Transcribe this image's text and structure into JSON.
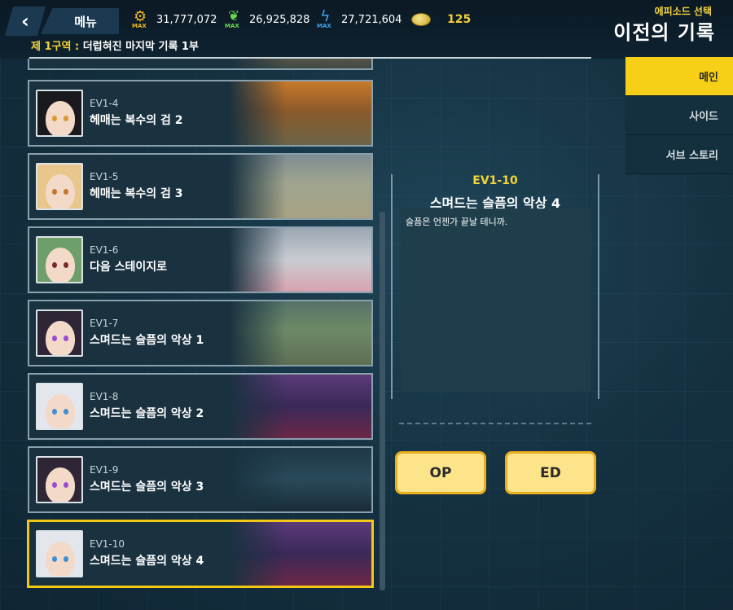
{
  "header": {
    "back_icon": "chevron-left-icon",
    "menu_label": "메뉴",
    "resources": [
      {
        "icon": "gear-max-icon",
        "max_label": "MAX",
        "value": "31,777,072",
        "color": "#f0b422"
      },
      {
        "icon": "leaf-max-icon",
        "max_label": "MAX",
        "value": "26,925,828",
        "color": "#6bd84a"
      },
      {
        "icon": "bolt-max-icon",
        "max_label": "MAX",
        "value": "27,721,604",
        "color": "#3ba4ea"
      }
    ],
    "coin": {
      "icon": "coin-icon",
      "value": "125"
    },
    "episode_select_label": "에피소드 선택",
    "page_title": "이전의 기록",
    "subtitle_highlight": "제 1구역 :",
    "subtitle_rest": "더럽혀진 마지막 기록 1부"
  },
  "episodes": [
    {
      "code": "EV1-4",
      "name": "헤매는 복수의 검 2",
      "hair": "#1a1a1e",
      "eye": "#d79a2e",
      "bg": "linear-gradient(180deg,#c87a2a 0%,#8d5a2a 45%,#6b6448 100%)"
    },
    {
      "code": "EV1-5",
      "name": "헤매는 복수의 검 3",
      "hair": "#e8c68c",
      "eye": "#c5762a",
      "bg": "linear-gradient(180deg,#7f8c92 0%,#9fa58e 45%,#a7a184 100%)"
    },
    {
      "code": "EV1-6",
      "name": "다음 스테이지로",
      "hair": "#6e9e6a",
      "eye": "#7a2a2a",
      "bg": "linear-gradient(180deg,#9aa7b3 0%,#c9ccd2 50%,#d9a2b0 100%)"
    },
    {
      "code": "EV1-7",
      "name": "스며드는 슬픔의 악상 1",
      "hair": "#2e2636",
      "eye": "#9d4ad2",
      "bg": "linear-gradient(180deg,#55726a 0%,#6d8a66 45%,#5e6e54 100%)"
    },
    {
      "code": "EV1-8",
      "name": "스며드는 슬픔의 악상 2",
      "hair": "#e4e6ee",
      "eye": "#3d8fd4",
      "bg": "linear-gradient(180deg,#5b3a7a 0%,#3a2958 50%,#6d2848 100%)"
    },
    {
      "code": "EV1-9",
      "name": "스며드는 슬픔의 악상 3",
      "hair": "#2e2636",
      "eye": "#9d4ad2",
      "bg": "linear-gradient(180deg,#1f3848 0%,#294a5a 50%,#1a2c38 100%)"
    },
    {
      "code": "EV1-10",
      "name": "스며드는 슬픔의 악상 4",
      "hair": "#e4e6ee",
      "eye": "#3d8fd4",
      "bg": "linear-gradient(180deg,#5b3a7a 0%,#3a2958 50%,#6d2848 100%)"
    }
  ],
  "selected_episode": {
    "code": "EV1-10",
    "name": "스며드는 슬픔의 악상 4",
    "description": "슬픔은 언젠가 끝날 테니까."
  },
  "buttons": {
    "op_label": "OP",
    "ed_label": "ED"
  },
  "side_tabs": [
    {
      "label": "메인",
      "active": true
    },
    {
      "label": "사이드",
      "active": false
    },
    {
      "label": "서브 스토리",
      "active": false
    }
  ],
  "colors": {
    "accent": "#f7cf16",
    "button": "#fde48a",
    "highlight_text": "#f4d43c"
  }
}
